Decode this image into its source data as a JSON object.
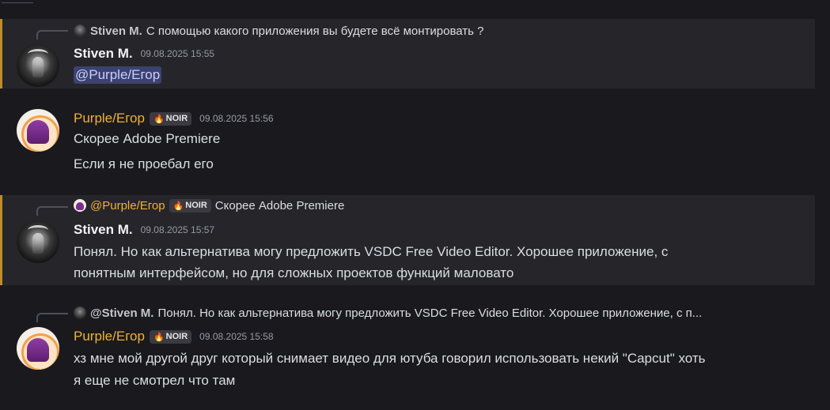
{
  "colors": {
    "background": "#1a1a1e",
    "highlight_background": "#26252a",
    "highlight_border": "#c08a2a",
    "name_yellow": "#f0b232",
    "mention_bg": "#3c4270"
  },
  "messages": [
    {
      "reply": {
        "avatar_icon": "dark-avatar-icon",
        "author": "Stiven M.",
        "text": "С помощью какого приложения вы будете всё монтировать ?"
      },
      "author": "Stiven M.",
      "timestamp": "09.08.2025 15:55",
      "mention": "@Purple/Егор"
    },
    {
      "author": "Purple/Егор",
      "tag": {
        "icon": "flame-icon",
        "label": "NOIR"
      },
      "timestamp": "09.08.2025 15:56",
      "lines": [
        "Скорее Adobe Premiere",
        "Если я не проебал его"
      ]
    },
    {
      "reply": {
        "avatar_icon": "purple-avatar-icon",
        "author": "@Purple/Егор",
        "tag": {
          "icon": "flame-icon",
          "label": "NOIR"
        },
        "text": "Скорее Adobe Premiere"
      },
      "author": "Stiven M.",
      "timestamp": "09.08.2025 15:57",
      "lines": [
        "Понял. Но как альтернатива могу предложить VSDC Free Video Editor. Хорошее приложение, с",
        "понятным интерфейсом, но для сложных проектов функций маловато"
      ]
    },
    {
      "reply": {
        "avatar_icon": "dark-avatar-icon",
        "author": "@Stiven M.",
        "text": "Понял. Но как альтернатива могу предложить VSDC Free Video Editor. Хорошее приложение, с п..."
      },
      "author": "Purple/Егор",
      "tag": {
        "icon": "flame-icon",
        "label": "NOIR"
      },
      "timestamp": "09.08.2025 15:58",
      "lines": [
        "хз мне мой другой друг который снимает видео для ютуба говорил использовать некий \"Capcut\" хоть",
        "я еще не смотрел что там"
      ]
    }
  ]
}
